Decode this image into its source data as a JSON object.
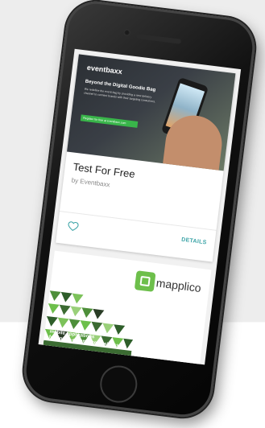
{
  "card": {
    "hero": {
      "logo": "eventbaxx",
      "headline": "Beyond the Digital Goodie Bag",
      "body": "We redefine the event bag by providing a new delivery channel to connect brands with their targeting consumers.",
      "cta": "Register for free at eventbaxx.com"
    },
    "title": "Test For Free",
    "subtitle": "by Eventbaxx",
    "details_label": "DETAILS"
  },
  "card2": {
    "brand": "mapplico",
    "tagline_line1": "mobile applications",
    "tagline_line2": "for your e-commerce business"
  },
  "colors": {
    "accent": "#3aa3a6",
    "brand_green": "#6dbf4b"
  },
  "icons": {
    "favorite": "heart-outline-icon"
  }
}
